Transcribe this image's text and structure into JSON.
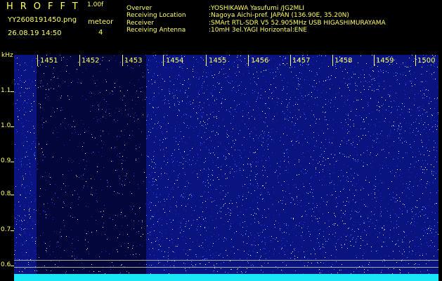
{
  "header": {
    "logo": "HROFFT",
    "version": "1.00f",
    "filename": "YY2608191450.png",
    "datetime": "26.08.19 14:50",
    "meteor_label": "meteor",
    "meteor_count": "4"
  },
  "info": [
    {
      "key": "Overver",
      "value": ":YOSHIKAWA Yasufumi /JG2MLI"
    },
    {
      "key": "Receiving Location",
      "value": ":Nagoya Aichi-pref. JAPAN (136.90E, 35.20N)"
    },
    {
      "key": "Receiver",
      "value": ":SMArt RTL-SDR V5 52.905MHz USB HIGASHIMURAYAMA"
    },
    {
      "key": "Receiving Antenna",
      "value": ":10mH 3el.YAGI Horizontal:ENE"
    }
  ],
  "axes": {
    "y_unit": "kHz",
    "y_labels": [
      "1.1",
      "1.0",
      "0.9",
      "0.8",
      "0.7",
      "0.6"
    ],
    "x_labels": [
      "1451",
      "1452",
      "1453",
      "1454",
      "1455",
      "1456",
      "1457",
      "1458",
      "1459",
      "1500"
    ]
  },
  "colors": {
    "text": "#ffff66",
    "background": "#000000",
    "spectrogram_base": "#02032a",
    "signal_bar": "#19e7f5"
  }
}
